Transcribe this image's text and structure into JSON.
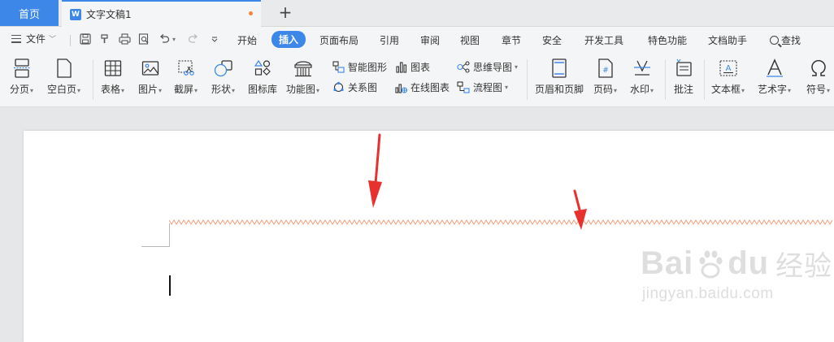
{
  "tabs": {
    "home": "首页",
    "doc_title": "文字文稿1",
    "new_tab": "+"
  },
  "menubar": {
    "file": "文件",
    "items": [
      "开始",
      "插入",
      "页面布局",
      "引用",
      "审阅",
      "视图",
      "章节",
      "安全",
      "开发工具",
      "特色功能",
      "文档助手"
    ],
    "active": "插入",
    "search": "查找"
  },
  "ribbon": {
    "large": [
      {
        "label": "分页",
        "dropdown": true
      },
      {
        "label": "空白页",
        "dropdown": true
      },
      {
        "label": "表格",
        "dropdown": true
      },
      {
        "label": "图片",
        "dropdown": true
      },
      {
        "label": "截屏",
        "dropdown": true
      },
      {
        "label": "形状",
        "dropdown": true
      },
      {
        "label": "图标库",
        "dropdown": false
      },
      {
        "label": "功能图",
        "dropdown": true
      },
      {
        "label": "页眉和页脚",
        "dropdown": false
      },
      {
        "label": "页码",
        "dropdown": true
      },
      {
        "label": "水印",
        "dropdown": true
      },
      {
        "label": "批注",
        "dropdown": false
      },
      {
        "label": "文本框",
        "dropdown": true
      },
      {
        "label": "艺术字",
        "dropdown": true
      },
      {
        "label": "符号",
        "dropdown": true
      }
    ],
    "small": [
      {
        "label": "智能图形"
      },
      {
        "label": "关系图"
      },
      {
        "label": "图表"
      },
      {
        "label": "在线图表"
      },
      {
        "label": "思维导图"
      },
      {
        "label": "流程图"
      }
    ]
  },
  "watermark": {
    "brand": "Bai",
    "brand2": "du",
    "cn": "经验",
    "url": "jingyan.baidu.com"
  },
  "colors": {
    "accent": "#3c87e8",
    "arrow": "#e8312f",
    "spellcheck": "#f0a07a"
  }
}
